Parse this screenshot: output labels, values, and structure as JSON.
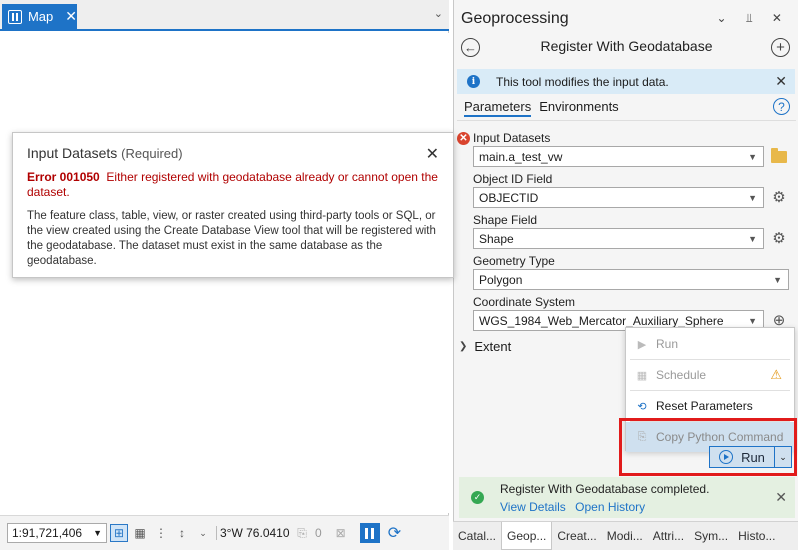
{
  "map": {
    "tab_label": "Map",
    "tab_close": "✕",
    "tab_chevron": "⌄",
    "statusbar": {
      "scale": "1:91,721,406",
      "coords": "3°W 76.0410",
      "selected_count": "0"
    }
  },
  "tooltip": {
    "title": "Input Datasets",
    "required": "(Required)",
    "close": "✕",
    "error_code": "Error 001050",
    "error_text": "Either registered with geodatabase already or cannot open the dataset.",
    "description": "The feature class, table, view, or raster created using third-party tools or SQL, or the view created using the Create Database View tool that will be registered with the geodatabase. The dataset must exist in the same database as the geodatabase."
  },
  "geoprocessing": {
    "title": "Geoprocessing",
    "window_controls": "⌄ ⫫ ✕",
    "tool_name": "Register With Geodatabase",
    "info_message": "This tool modifies the input data.",
    "tabs": [
      "Parameters",
      "Environments"
    ],
    "params": {
      "input_datasets": {
        "label": "Input Datasets",
        "value": "main.a_test_vw"
      },
      "object_id": {
        "label": "Object ID Field",
        "value": "OBJECTID"
      },
      "shape": {
        "label": "Shape Field",
        "value": "Shape"
      },
      "geometry": {
        "label": "Geometry Type",
        "value": "Polygon"
      },
      "coord_system": {
        "label": "Coordinate System",
        "value": "WGS_1984_Web_Mercator_Auxiliary_Sphere"
      }
    },
    "extent_label": "Extent",
    "run_menu": {
      "run": "Run",
      "schedule": "Schedule",
      "reset": "Reset Parameters",
      "copy_python": "Copy Python Command"
    },
    "run_button": "Run",
    "completion": {
      "message": "Register With Geodatabase completed.",
      "view_details": "View Details",
      "open_history": "Open History"
    }
  },
  "bottom_tabs": [
    "Catal...",
    "Geop...",
    "Creat...",
    "Modi...",
    "Attri...",
    "Sym...",
    "Histo..."
  ],
  "colors": {
    "accent": "#1e73c7",
    "error": "#b00000",
    "success": "#35a853",
    "highlight": "#e11b1b"
  }
}
